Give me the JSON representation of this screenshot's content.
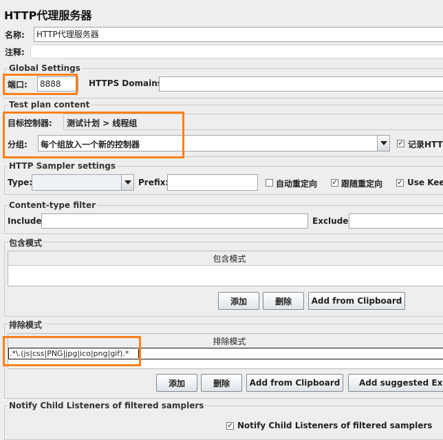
{
  "header": {
    "title": "HTTP代理服务器"
  },
  "name_row": {
    "label": "名称:",
    "value": "HTTP代理服务器"
  },
  "comment_row": {
    "label": "注释:",
    "value": ""
  },
  "global_settings": {
    "legend": "Global Settings",
    "port_label": "端口:",
    "port_value": "8888",
    "https_label": "HTTPS Domains :",
    "https_value": ""
  },
  "test_plan": {
    "legend": "Test plan content",
    "target_label": "目标控制器:",
    "target_value": "测试计划 > 线程组",
    "grouping_label": "分组:",
    "grouping_value": "每个组放入一个新的控制器",
    "record_label": "记录HTT",
    "record_checked": true
  },
  "sampler": {
    "legend": "HTTP Sampler settings",
    "type_label": "Type:",
    "type_value": "",
    "prefix_label": "Prefix:",
    "prefix_value": "",
    "auto_redirect_label": "自动重定向",
    "follow_redirect_label": "跟随重定向",
    "keepalive_label": "Use Kee"
  },
  "content_type": {
    "legend": "Content-type filter",
    "include_label": "Include:",
    "include_value": "",
    "exclude_label": "Exclude:",
    "exclude_value": ""
  },
  "include_patterns": {
    "legend": "包含模式",
    "column_header": "包含模式",
    "add_button": "添加",
    "delete_button": "删除",
    "clipboard_button": "Add from Clipboard"
  },
  "exclude_patterns": {
    "legend": "排除模式",
    "column_header": "排除模式",
    "row_value": ".*\\.(js|css|PNG|jpg|ico|png|gif).*",
    "add_button": "添加",
    "delete_button": "删除",
    "clipboard_button": "Add from Clipboard",
    "suggested_button": "Add suggested Exclu"
  },
  "notify": {
    "legend": "Notify Child Listeners of filtered samplers",
    "checkbox_label": "Notify Child Listeners of filtered samplers",
    "checked": true
  },
  "colors": {
    "highlight": "#ff7f16",
    "background": "#eeeeee"
  }
}
